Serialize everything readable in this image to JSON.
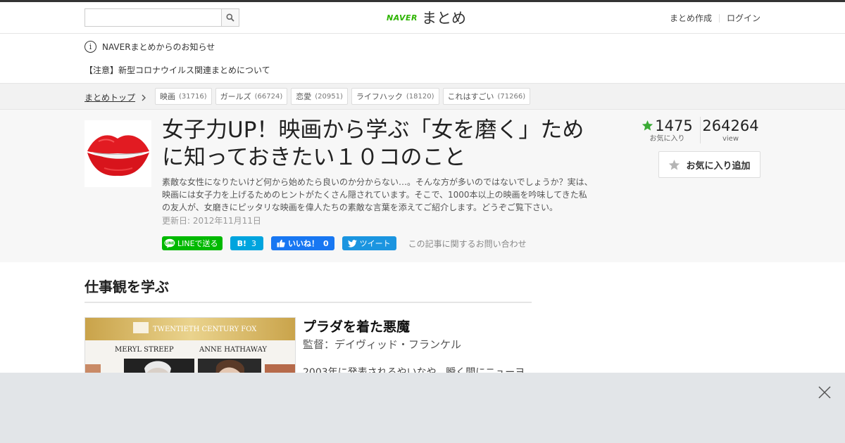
{
  "header": {
    "search_placeholder": "",
    "logo_brand": "NAVER",
    "logo_name": "まとめ",
    "links": [
      "まとめ作成",
      "ログイン"
    ]
  },
  "notice": {
    "title": "NAVERまとめからのお知らせ",
    "link": "【注意】新型コロナウイルス関連まとめについて"
  },
  "breadcrumb": {
    "top": "まとめトップ"
  },
  "tags": [
    {
      "label": "映画",
      "count": "(31716)"
    },
    {
      "label": "ガールズ",
      "count": "(66724)"
    },
    {
      "label": "恋愛",
      "count": "(20951)"
    },
    {
      "label": "ライフハック",
      "count": "(18120)"
    },
    {
      "label": "これはすごい",
      "count": "(71266)"
    }
  ],
  "article": {
    "title": "女子力UP！映画から学ぶ「女を磨く」ために知っておきたい１０コのこと",
    "description": "素敵な女性になりたいけど何から始めたら良いのか分からない…。そんな方が多いのではないでしょうか？実は、映画には女子力を上げるためのヒントがたくさん隠されています。そこで、1000本以上の映画を吟味してきた私の友人が、女磨きにピッタリな映画を偉人たちの素敵な言葉を添えてご紹介します。どうぞご覧下さい。",
    "updated": "更新日: 2012年11月11日",
    "favorites": "1475",
    "favorites_label": "お気に入り",
    "views": "264264",
    "views_label": "view",
    "fav_button": "お気に入り追加"
  },
  "share": {
    "line": "LINEで送る",
    "hatena": "B!",
    "hatena_count": "3",
    "fb": "いいね！",
    "fb_count": "0",
    "tweet": "ツイート",
    "contact": "この記事に関するお問い合わせ"
  },
  "section": {
    "heading": "仕事観を学ぶ"
  },
  "movie": {
    "poster_studio": "TWENTIETH CENTURY FOX",
    "poster_actor1": "MERYL STREEP",
    "poster_actor2": "ANNE HATHAWAY",
    "title": "プラダを着た悪魔",
    "director": "監督：デイヴィッド・フランケル",
    "text": "2003年に発表されるやいなや、瞬く間にニューヨ"
  },
  "colors": {
    "naver_green": "#2db400",
    "line_green": "#00b900",
    "hatena_blue": "#00a4de",
    "fb_blue": "#1877f2",
    "twitter_blue": "#1b95e0",
    "star_green": "#3aaa35"
  }
}
